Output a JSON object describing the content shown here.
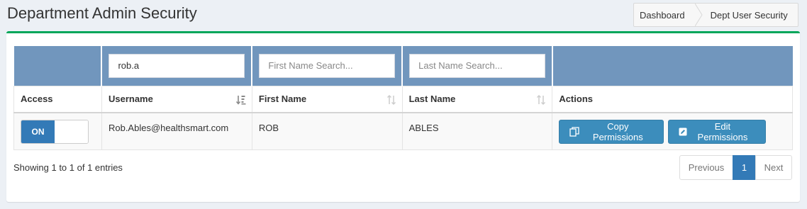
{
  "page": {
    "title": "Department Admin Security"
  },
  "breadcrumb": {
    "items": [
      "Dashboard",
      "Dept User Security"
    ]
  },
  "filters": {
    "username": {
      "value": "rob.a",
      "placeholder": ""
    },
    "first_name": {
      "value": "",
      "placeholder": "First Name Search..."
    },
    "last_name": {
      "value": "",
      "placeholder": "Last Name Search..."
    }
  },
  "table": {
    "columns": [
      "Access",
      "Username",
      "First Name",
      "Last Name",
      "Actions"
    ],
    "rows": [
      {
        "access": "ON",
        "username": "Rob.Ables@healthsmart.com",
        "first_name": "ROB",
        "last_name": "ABLES",
        "copy_label": "Copy Permissions",
        "edit_label": "Edit Permissions"
      }
    ]
  },
  "footer": {
    "info": "Showing 1 to 1 of 1 entries",
    "pagination": {
      "previous": "Previous",
      "current": "1",
      "next": "Next"
    }
  },
  "colors": {
    "accent_border": "#00a65a",
    "filter_row_bg": "#7196bd",
    "button_bg": "#3c8dbc",
    "toggle_on_bg": "#337ab7",
    "page_active_bg": "#337ab7"
  },
  "icons": {
    "username_sort": "sort-alpha-down-icon",
    "first_name_sort": "sort-both-icon",
    "last_name_sort": "sort-both-icon",
    "copy_button": "copy-icon",
    "edit_button": "edit-icon"
  }
}
